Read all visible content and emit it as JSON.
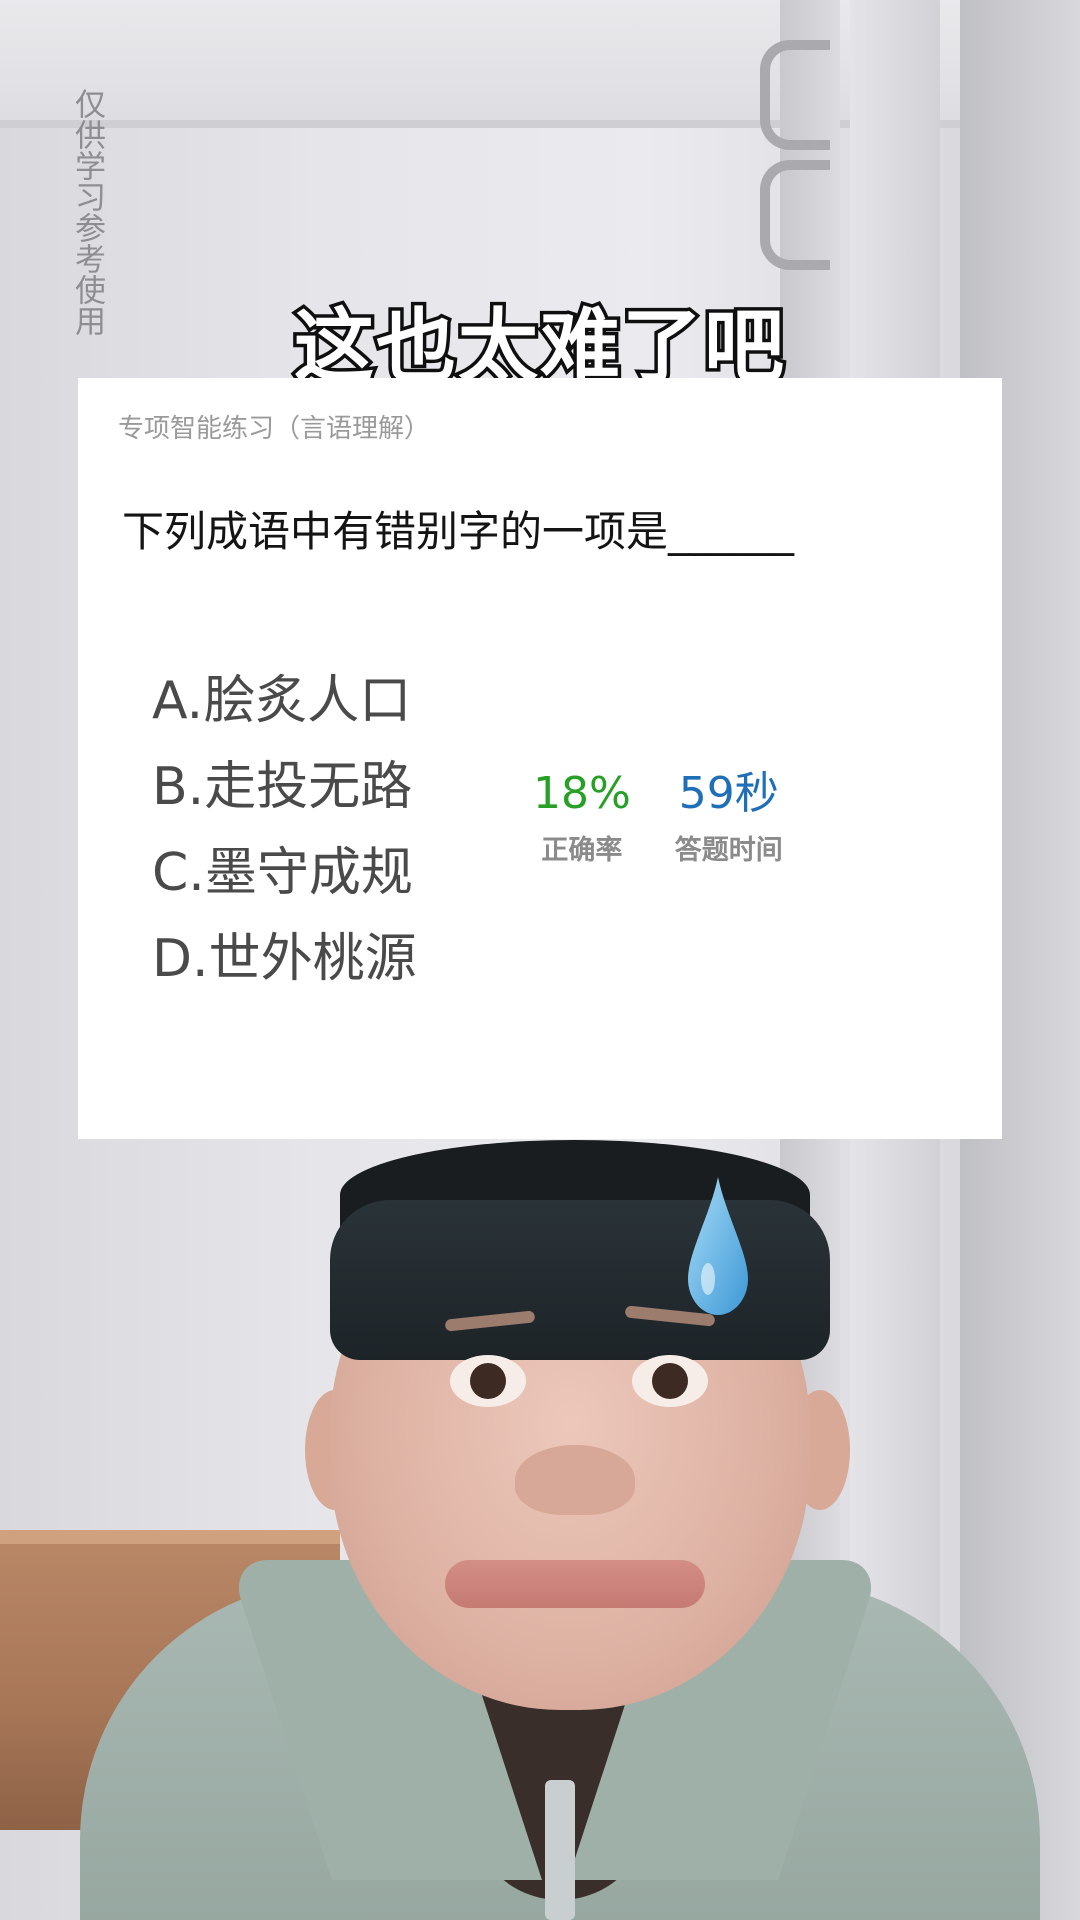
{
  "watermark": "仅供学习参考使用",
  "headline": "这也太难了吧",
  "card": {
    "label": "专项智能练习（言语理解）",
    "question": "下列成语中有错别字的一项是______",
    "options": [
      {
        "text": "A.脍炙人口"
      },
      {
        "text": "B.走投无路"
      },
      {
        "text": "C.墨守成规"
      },
      {
        "text": "D.世外桃源"
      }
    ],
    "stats": {
      "accuracy_value": "18%",
      "accuracy_label": "正确率",
      "time_value": "59秒",
      "time_label": "答题时间"
    }
  },
  "colors": {
    "accuracy": "#26a126",
    "time": "#1f6fb8",
    "headline_stroke": "#0f0f0f"
  },
  "icons": [
    "sweat-drop-icon"
  ]
}
